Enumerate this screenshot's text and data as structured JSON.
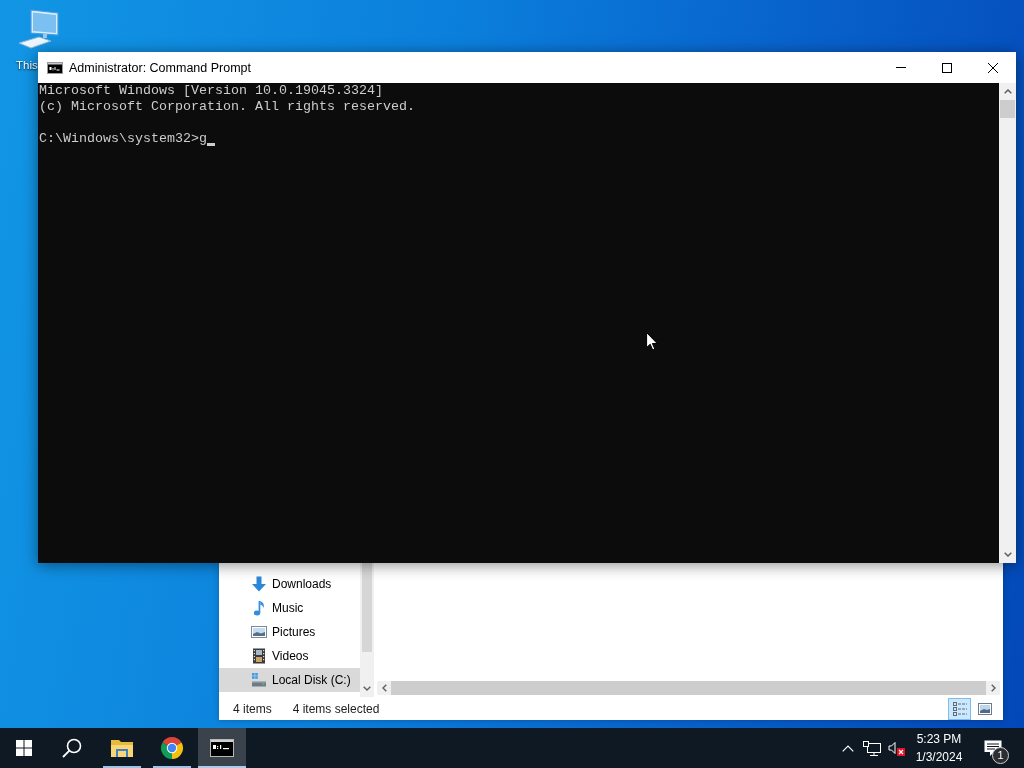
{
  "desktop": {
    "icons": [
      {
        "kind": "computer",
        "label": "This"
      }
    ]
  },
  "console_window": {
    "title": "Administrator: Command Prompt",
    "output_lines": [
      "Microsoft Windows [Version 10.0.19045.3324]",
      "(c) Microsoft Corporation. All rights reserved."
    ],
    "prompt_line": "C:\\Windows\\system32>g"
  },
  "explorer_window": {
    "nav_items": [
      {
        "kind": "downloads",
        "label": "Downloads",
        "selected": false
      },
      {
        "kind": "music",
        "label": "Music",
        "selected": false
      },
      {
        "kind": "pictures",
        "label": "Pictures",
        "selected": false
      },
      {
        "kind": "videos",
        "label": "Videos",
        "selected": false
      },
      {
        "kind": "drive",
        "label": "Local Disk (C:)",
        "selected": true
      }
    ],
    "status_bar": {
      "item_count": "4 items",
      "selection_count": "4 items selected"
    },
    "view_buttons": [
      {
        "kind": "details",
        "selected": true
      },
      {
        "kind": "large-icons",
        "selected": false
      }
    ]
  },
  "taskbar": {
    "apps": [
      {
        "kind": "folder",
        "running": true,
        "selected": false
      },
      {
        "kind": "browser",
        "running": true,
        "selected": false
      },
      {
        "kind": "console",
        "running": true,
        "selected": true
      }
    ],
    "tray": {
      "volume_muted": true,
      "time": "5:23 PM",
      "date": "1/3/2024",
      "notification_count": "1"
    }
  }
}
